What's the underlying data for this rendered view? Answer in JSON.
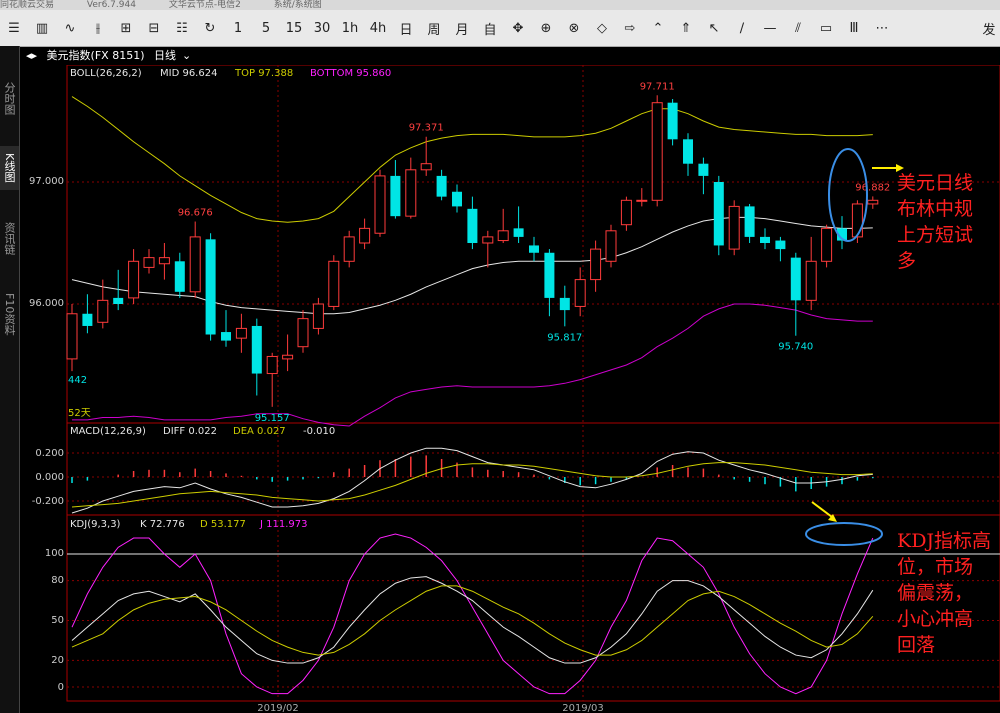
{
  "titlebar": {
    "app": "同花顺云交易",
    "version": "Ver6.7.944",
    "node": "文华云节点-电信2",
    "menu": "系统/系统图"
  },
  "toolbar": {
    "items": [
      "1",
      "5",
      "15",
      "30",
      "1h",
      "4h",
      "日",
      "周",
      "月",
      "自"
    ],
    "right_label": "发"
  },
  "sidebar": {
    "tabs": [
      "分时图",
      "K线图",
      "资讯链",
      "F10资料"
    ],
    "active": 1
  },
  "symbol": {
    "name": "美元指数(FX 8151)",
    "period": "日线"
  },
  "boll": {
    "label": "BOLL(26,26,2)",
    "mid": "MID 96.624",
    "top": "TOP 97.388",
    "bottom": "BOTTOM 95.860"
  },
  "macd": {
    "label": "MACD(12,26,9)",
    "diff": "DIFF 0.022",
    "dea": "DEA 0.027",
    "macd": "-0.010"
  },
  "kdj": {
    "label": "KDJ(9,3,3)",
    "k": "K 72.776",
    "d": "D 53.177",
    "j": "J 111.973"
  },
  "price_axis": [
    "97.000",
    "96.000"
  ],
  "macd_axis": [
    "0.200",
    "0.000",
    "-0.200"
  ],
  "kdj_axis": [
    "100",
    "80",
    "50",
    "20",
    "0"
  ],
  "date_labels": [
    "2019/02",
    "2019/03"
  ],
  "left_price_note": "442",
  "days_note": "52天",
  "colors": {
    "up": "#ff3b3b",
    "down": "#00e5e5",
    "mid": "#e6e6e6",
    "top": "#cccc00",
    "bottom": "#cc00cc",
    "k": "#e6e6e6",
    "d": "#cccc00",
    "j": "#ff22ff",
    "annotation": "#ff2020"
  },
  "annotations": {
    "boll_note": [
      "美元日线",
      "布林中规",
      "上方短试",
      "多"
    ],
    "kdj_note": [
      "KDJ指标高",
      "位，市场",
      "偏震荡，",
      "小心冲高",
      "回落"
    ]
  },
  "chart_data": {
    "type": "candlestick",
    "price_labels": {
      "high1": "96.676",
      "high2": "97.371",
      "high3": "97.711",
      "last": "96.882",
      "low1": "95.157",
      "low2": "95.817",
      "low3": "95.740"
    },
    "candles": [
      {
        "o": 95.55,
        "c": 95.92,
        "h": 96.0,
        "l": 95.45
      },
      {
        "o": 95.92,
        "c": 95.82,
        "h": 96.08,
        "l": 95.76
      },
      {
        "o": 95.85,
        "c": 96.03,
        "h": 96.2,
        "l": 95.8
      },
      {
        "o": 96.05,
        "c": 96.0,
        "h": 96.28,
        "l": 95.95
      },
      {
        "o": 96.05,
        "c": 96.35,
        "h": 96.45,
        "l": 96.0
      },
      {
        "o": 96.3,
        "c": 96.38,
        "h": 96.45,
        "l": 96.25
      },
      {
        "o": 96.33,
        "c": 96.38,
        "h": 96.5,
        "l": 96.2
      },
      {
        "o": 96.35,
        "c": 96.1,
        "h": 96.42,
        "l": 96.05
      },
      {
        "o": 96.1,
        "c": 96.55,
        "h": 96.676,
        "l": 96.05
      },
      {
        "o": 96.53,
        "c": 95.75,
        "h": 96.58,
        "l": 95.7
      },
      {
        "o": 95.77,
        "c": 95.7,
        "h": 95.95,
        "l": 95.65
      },
      {
        "o": 95.72,
        "c": 95.8,
        "h": 95.92,
        "l": 95.6
      },
      {
        "o": 95.82,
        "c": 95.43,
        "h": 95.88,
        "l": 95.25
      },
      {
        "o": 95.43,
        "c": 95.57,
        "h": 95.6,
        "l": 95.157
      },
      {
        "o": 95.55,
        "c": 95.58,
        "h": 95.75,
        "l": 95.45
      },
      {
        "o": 95.65,
        "c": 95.88,
        "h": 95.95,
        "l": 95.6
      },
      {
        "o": 95.8,
        "c": 96.0,
        "h": 96.05,
        "l": 95.75
      },
      {
        "o": 95.98,
        "c": 96.35,
        "h": 96.4,
        "l": 95.95
      },
      {
        "o": 96.35,
        "c": 96.55,
        "h": 96.6,
        "l": 96.3
      },
      {
        "o": 96.5,
        "c": 96.62,
        "h": 96.7,
        "l": 96.45
      },
      {
        "o": 96.58,
        "c": 97.05,
        "h": 97.1,
        "l": 96.55
      },
      {
        "o": 97.05,
        "c": 96.72,
        "h": 97.18,
        "l": 96.7
      },
      {
        "o": 96.72,
        "c": 97.1,
        "h": 97.2,
        "l": 96.7
      },
      {
        "o": 97.1,
        "c": 97.15,
        "h": 97.371,
        "l": 97.05
      },
      {
        "o": 97.05,
        "c": 96.88,
        "h": 97.1,
        "l": 96.85
      },
      {
        "o": 96.92,
        "c": 96.8,
        "h": 96.98,
        "l": 96.75
      },
      {
        "o": 96.78,
        "c": 96.5,
        "h": 96.88,
        "l": 96.45
      },
      {
        "o": 96.5,
        "c": 96.55,
        "h": 96.6,
        "l": 96.3
      },
      {
        "o": 96.52,
        "c": 96.6,
        "h": 96.78,
        "l": 96.5
      },
      {
        "o": 96.62,
        "c": 96.55,
        "h": 96.8,
        "l": 96.5
      },
      {
        "o": 96.48,
        "c": 96.42,
        "h": 96.55,
        "l": 96.35
      },
      {
        "o": 96.42,
        "c": 96.05,
        "h": 96.45,
        "l": 95.9
      },
      {
        "o": 96.05,
        "c": 95.95,
        "h": 96.15,
        "l": 95.817
      },
      {
        "o": 95.98,
        "c": 96.2,
        "h": 96.3,
        "l": 95.9
      },
      {
        "o": 96.2,
        "c": 96.45,
        "h": 96.52,
        "l": 96.1
      },
      {
        "o": 96.35,
        "c": 96.6,
        "h": 96.65,
        "l": 96.3
      },
      {
        "o": 96.65,
        "c": 96.85,
        "h": 96.88,
        "l": 96.6
      },
      {
        "o": 96.85,
        "c": 96.85,
        "h": 96.95,
        "l": 96.8
      },
      {
        "o": 96.85,
        "c": 97.65,
        "h": 97.711,
        "l": 96.8
      },
      {
        "o": 97.65,
        "c": 97.35,
        "h": 97.68,
        "l": 97.3
      },
      {
        "o": 97.35,
        "c": 97.15,
        "h": 97.4,
        "l": 97.05
      },
      {
        "o": 97.15,
        "c": 97.05,
        "h": 97.2,
        "l": 96.9
      },
      {
        "o": 97.0,
        "c": 96.48,
        "h": 97.05,
        "l": 96.4
      },
      {
        "o": 96.45,
        "c": 96.8,
        "h": 96.85,
        "l": 96.4
      },
      {
        "o": 96.8,
        "c": 96.55,
        "h": 96.82,
        "l": 96.5
      },
      {
        "o": 96.55,
        "c": 96.5,
        "h": 96.62,
        "l": 96.45
      },
      {
        "o": 96.52,
        "c": 96.45,
        "h": 96.55,
        "l": 96.35
      },
      {
        "o": 96.38,
        "c": 96.03,
        "h": 96.42,
        "l": 95.74
      },
      {
        "o": 96.03,
        "c": 96.35,
        "h": 96.55,
        "l": 95.95
      },
      {
        "o": 96.35,
        "c": 96.62,
        "h": 96.65,
        "l": 96.3
      },
      {
        "o": 96.62,
        "c": 96.52,
        "h": 96.72,
        "l": 96.45
      },
      {
        "o": 96.55,
        "c": 96.82,
        "h": 96.85,
        "l": 96.5
      },
      {
        "o": 96.82,
        "c": 96.85,
        "h": 96.882,
        "l": 96.78
      }
    ],
    "boll_mid": [
      96.2,
      96.17,
      96.14,
      96.12,
      96.1,
      96.09,
      96.08,
      96.07,
      96.06,
      96.02,
      95.99,
      95.97,
      95.96,
      95.95,
      95.94,
      95.93,
      95.92,
      95.92,
      95.93,
      95.96,
      95.99,
      96.03,
      96.08,
      96.14,
      96.19,
      96.24,
      96.29,
      96.32,
      96.34,
      96.35,
      96.35,
      96.35,
      96.35,
      96.35,
      96.36,
      96.38,
      96.42,
      96.47,
      96.53,
      96.59,
      96.64,
      96.68,
      96.7,
      96.71,
      96.71,
      96.7,
      96.68,
      96.66,
      96.64,
      96.63,
      96.62,
      96.62,
      96.624
    ],
    "boll_top": [
      97.7,
      97.62,
      97.53,
      97.43,
      97.33,
      97.24,
      97.15,
      97.05,
      96.97,
      96.89,
      96.82,
      96.75,
      96.7,
      96.68,
      96.67,
      96.68,
      96.7,
      96.76,
      96.88,
      97.0,
      97.12,
      97.22,
      97.28,
      97.33,
      97.36,
      97.38,
      97.39,
      97.39,
      97.39,
      97.38,
      97.37,
      97.37,
      97.37,
      97.38,
      97.4,
      97.44,
      97.5,
      97.56,
      97.6,
      97.6,
      97.56,
      97.5,
      97.45,
      97.43,
      97.42,
      97.41,
      97.4,
      97.39,
      97.39,
      97.38,
      97.38,
      97.38,
      97.388
    ],
    "boll_bottom": [
      95.05,
      95.05,
      95.07,
      95.07,
      95.08,
      95.07,
      95.05,
      95.05,
      95.05,
      95.05,
      95.07,
      95.08,
      95.1,
      95.1,
      95.1,
      95.06,
      95.03,
      95.01,
      95.0,
      95.08,
      95.15,
      95.23,
      95.28,
      95.3,
      95.32,
      95.33,
      95.32,
      95.32,
      95.32,
      95.32,
      95.32,
      95.33,
      95.35,
      95.38,
      95.42,
      95.46,
      95.5,
      95.56,
      95.65,
      95.72,
      95.8,
      95.9,
      95.96,
      96.0,
      96.0,
      95.99,
      95.97,
      95.95,
      95.91,
      95.88,
      95.87,
      95.86,
      95.86
    ],
    "macd_hist": [
      -0.05,
      -0.03,
      0.0,
      0.02,
      0.05,
      0.06,
      0.06,
      0.04,
      0.07,
      0.05,
      0.03,
      0.01,
      -0.02,
      -0.04,
      -0.03,
      -0.02,
      -0.01,
      0.04,
      0.07,
      0.1,
      0.14,
      0.15,
      0.17,
      0.18,
      0.15,
      0.12,
      0.08,
      0.06,
      0.05,
      0.04,
      0.02,
      -0.02,
      -0.05,
      -0.07,
      -0.06,
      -0.04,
      -0.02,
      0.0,
      0.08,
      0.1,
      0.08,
      0.07,
      0.02,
      -0.02,
      -0.04,
      -0.06,
      -0.08,
      -0.12,
      -0.1,
      -0.08,
      -0.06,
      -0.03,
      -0.01
    ],
    "macd_diff": [
      -0.3,
      -0.26,
      -0.2,
      -0.16,
      -0.12,
      -0.1,
      -0.08,
      -0.09,
      -0.05,
      -0.1,
      -0.14,
      -0.17,
      -0.21,
      -0.25,
      -0.25,
      -0.24,
      -0.22,
      -0.18,
      -0.12,
      -0.03,
      0.07,
      0.14,
      0.2,
      0.24,
      0.24,
      0.22,
      0.17,
      0.12,
      0.1,
      0.08,
      0.06,
      0.01,
      -0.04,
      -0.08,
      -0.09,
      -0.06,
      -0.02,
      0.03,
      0.13,
      0.19,
      0.21,
      0.2,
      0.14,
      0.1,
      0.06,
      0.03,
      -0.01,
      -0.05,
      -0.05,
      -0.04,
      -0.02,
      0.01,
      0.022
    ],
    "macd_dea": [
      -0.25,
      -0.24,
      -0.23,
      -0.22,
      -0.2,
      -0.18,
      -0.16,
      -0.14,
      -0.13,
      -0.12,
      -0.13,
      -0.14,
      -0.15,
      -0.17,
      -0.18,
      -0.19,
      -0.2,
      -0.19,
      -0.18,
      -0.15,
      -0.11,
      -0.07,
      -0.02,
      0.03,
      0.07,
      0.1,
      0.11,
      0.11,
      0.1,
      0.1,
      0.09,
      0.07,
      0.05,
      0.03,
      0.01,
      0.0,
      0.0,
      0.01,
      0.03,
      0.06,
      0.09,
      0.11,
      0.12,
      0.12,
      0.11,
      0.1,
      0.08,
      0.06,
      0.04,
      0.03,
      0.02,
      0.02,
      0.027
    ],
    "kdj_k": [
      35,
      45,
      55,
      65,
      70,
      72,
      68,
      64,
      70,
      58,
      45,
      35,
      25,
      20,
      18,
      18,
      22,
      30,
      45,
      58,
      70,
      78,
      82,
      83,
      78,
      72,
      65,
      55,
      45,
      38,
      30,
      22,
      18,
      18,
      22,
      30,
      40,
      55,
      72,
      80,
      80,
      76,
      68,
      58,
      48,
      38,
      30,
      24,
      22,
      28,
      40,
      55,
      72.776
    ],
    "kdj_d": [
      30,
      35,
      40,
      50,
      58,
      63,
      66,
      67,
      68,
      64,
      58,
      50,
      42,
      35,
      30,
      26,
      24,
      26,
      32,
      40,
      50,
      58,
      65,
      72,
      76,
      76,
      72,
      66,
      60,
      55,
      48,
      40,
      33,
      28,
      24,
      24,
      28,
      35,
      45,
      55,
      65,
      70,
      72,
      68,
      62,
      55,
      48,
      42,
      35,
      30,
      32,
      40,
      53.177
    ],
    "kdj_j": [
      45,
      70,
      90,
      105,
      112,
      112,
      100,
      90,
      100,
      80,
      40,
      10,
      0,
      -5,
      -5,
      5,
      20,
      45,
      80,
      100,
      112,
      115,
      112,
      105,
      95,
      80,
      60,
      40,
      20,
      10,
      0,
      -5,
      -5,
      5,
      20,
      45,
      65,
      95,
      112,
      110,
      100,
      90,
      70,
      45,
      25,
      10,
      0,
      -5,
      0,
      20,
      55,
      85,
      111.973
    ]
  }
}
